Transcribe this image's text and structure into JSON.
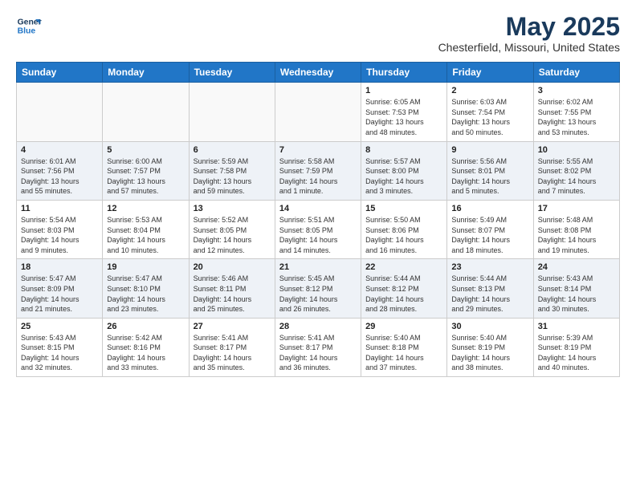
{
  "logo": {
    "line1": "General",
    "line2": "Blue"
  },
  "title": "May 2025",
  "subtitle": "Chesterfield, Missouri, United States",
  "weekdays": [
    "Sunday",
    "Monday",
    "Tuesday",
    "Wednesday",
    "Thursday",
    "Friday",
    "Saturday"
  ],
  "weeks": [
    [
      {
        "day": "",
        "info": ""
      },
      {
        "day": "",
        "info": ""
      },
      {
        "day": "",
        "info": ""
      },
      {
        "day": "",
        "info": ""
      },
      {
        "day": "1",
        "info": "Sunrise: 6:05 AM\nSunset: 7:53 PM\nDaylight: 13 hours\nand 48 minutes."
      },
      {
        "day": "2",
        "info": "Sunrise: 6:03 AM\nSunset: 7:54 PM\nDaylight: 13 hours\nand 50 minutes."
      },
      {
        "day": "3",
        "info": "Sunrise: 6:02 AM\nSunset: 7:55 PM\nDaylight: 13 hours\nand 53 minutes."
      }
    ],
    [
      {
        "day": "4",
        "info": "Sunrise: 6:01 AM\nSunset: 7:56 PM\nDaylight: 13 hours\nand 55 minutes."
      },
      {
        "day": "5",
        "info": "Sunrise: 6:00 AM\nSunset: 7:57 PM\nDaylight: 13 hours\nand 57 minutes."
      },
      {
        "day": "6",
        "info": "Sunrise: 5:59 AM\nSunset: 7:58 PM\nDaylight: 13 hours\nand 59 minutes."
      },
      {
        "day": "7",
        "info": "Sunrise: 5:58 AM\nSunset: 7:59 PM\nDaylight: 14 hours\nand 1 minute."
      },
      {
        "day": "8",
        "info": "Sunrise: 5:57 AM\nSunset: 8:00 PM\nDaylight: 14 hours\nand 3 minutes."
      },
      {
        "day": "9",
        "info": "Sunrise: 5:56 AM\nSunset: 8:01 PM\nDaylight: 14 hours\nand 5 minutes."
      },
      {
        "day": "10",
        "info": "Sunrise: 5:55 AM\nSunset: 8:02 PM\nDaylight: 14 hours\nand 7 minutes."
      }
    ],
    [
      {
        "day": "11",
        "info": "Sunrise: 5:54 AM\nSunset: 8:03 PM\nDaylight: 14 hours\nand 9 minutes."
      },
      {
        "day": "12",
        "info": "Sunrise: 5:53 AM\nSunset: 8:04 PM\nDaylight: 14 hours\nand 10 minutes."
      },
      {
        "day": "13",
        "info": "Sunrise: 5:52 AM\nSunset: 8:05 PM\nDaylight: 14 hours\nand 12 minutes."
      },
      {
        "day": "14",
        "info": "Sunrise: 5:51 AM\nSunset: 8:05 PM\nDaylight: 14 hours\nand 14 minutes."
      },
      {
        "day": "15",
        "info": "Sunrise: 5:50 AM\nSunset: 8:06 PM\nDaylight: 14 hours\nand 16 minutes."
      },
      {
        "day": "16",
        "info": "Sunrise: 5:49 AM\nSunset: 8:07 PM\nDaylight: 14 hours\nand 18 minutes."
      },
      {
        "day": "17",
        "info": "Sunrise: 5:48 AM\nSunset: 8:08 PM\nDaylight: 14 hours\nand 19 minutes."
      }
    ],
    [
      {
        "day": "18",
        "info": "Sunrise: 5:47 AM\nSunset: 8:09 PM\nDaylight: 14 hours\nand 21 minutes."
      },
      {
        "day": "19",
        "info": "Sunrise: 5:47 AM\nSunset: 8:10 PM\nDaylight: 14 hours\nand 23 minutes."
      },
      {
        "day": "20",
        "info": "Sunrise: 5:46 AM\nSunset: 8:11 PM\nDaylight: 14 hours\nand 25 minutes."
      },
      {
        "day": "21",
        "info": "Sunrise: 5:45 AM\nSunset: 8:12 PM\nDaylight: 14 hours\nand 26 minutes."
      },
      {
        "day": "22",
        "info": "Sunrise: 5:44 AM\nSunset: 8:12 PM\nDaylight: 14 hours\nand 28 minutes."
      },
      {
        "day": "23",
        "info": "Sunrise: 5:44 AM\nSunset: 8:13 PM\nDaylight: 14 hours\nand 29 minutes."
      },
      {
        "day": "24",
        "info": "Sunrise: 5:43 AM\nSunset: 8:14 PM\nDaylight: 14 hours\nand 30 minutes."
      }
    ],
    [
      {
        "day": "25",
        "info": "Sunrise: 5:43 AM\nSunset: 8:15 PM\nDaylight: 14 hours\nand 32 minutes."
      },
      {
        "day": "26",
        "info": "Sunrise: 5:42 AM\nSunset: 8:16 PM\nDaylight: 14 hours\nand 33 minutes."
      },
      {
        "day": "27",
        "info": "Sunrise: 5:41 AM\nSunset: 8:17 PM\nDaylight: 14 hours\nand 35 minutes."
      },
      {
        "day": "28",
        "info": "Sunrise: 5:41 AM\nSunset: 8:17 PM\nDaylight: 14 hours\nand 36 minutes."
      },
      {
        "day": "29",
        "info": "Sunrise: 5:40 AM\nSunset: 8:18 PM\nDaylight: 14 hours\nand 37 minutes."
      },
      {
        "day": "30",
        "info": "Sunrise: 5:40 AM\nSunset: 8:19 PM\nDaylight: 14 hours\nand 38 minutes."
      },
      {
        "day": "31",
        "info": "Sunrise: 5:39 AM\nSunset: 8:19 PM\nDaylight: 14 hours\nand 40 minutes."
      }
    ]
  ]
}
